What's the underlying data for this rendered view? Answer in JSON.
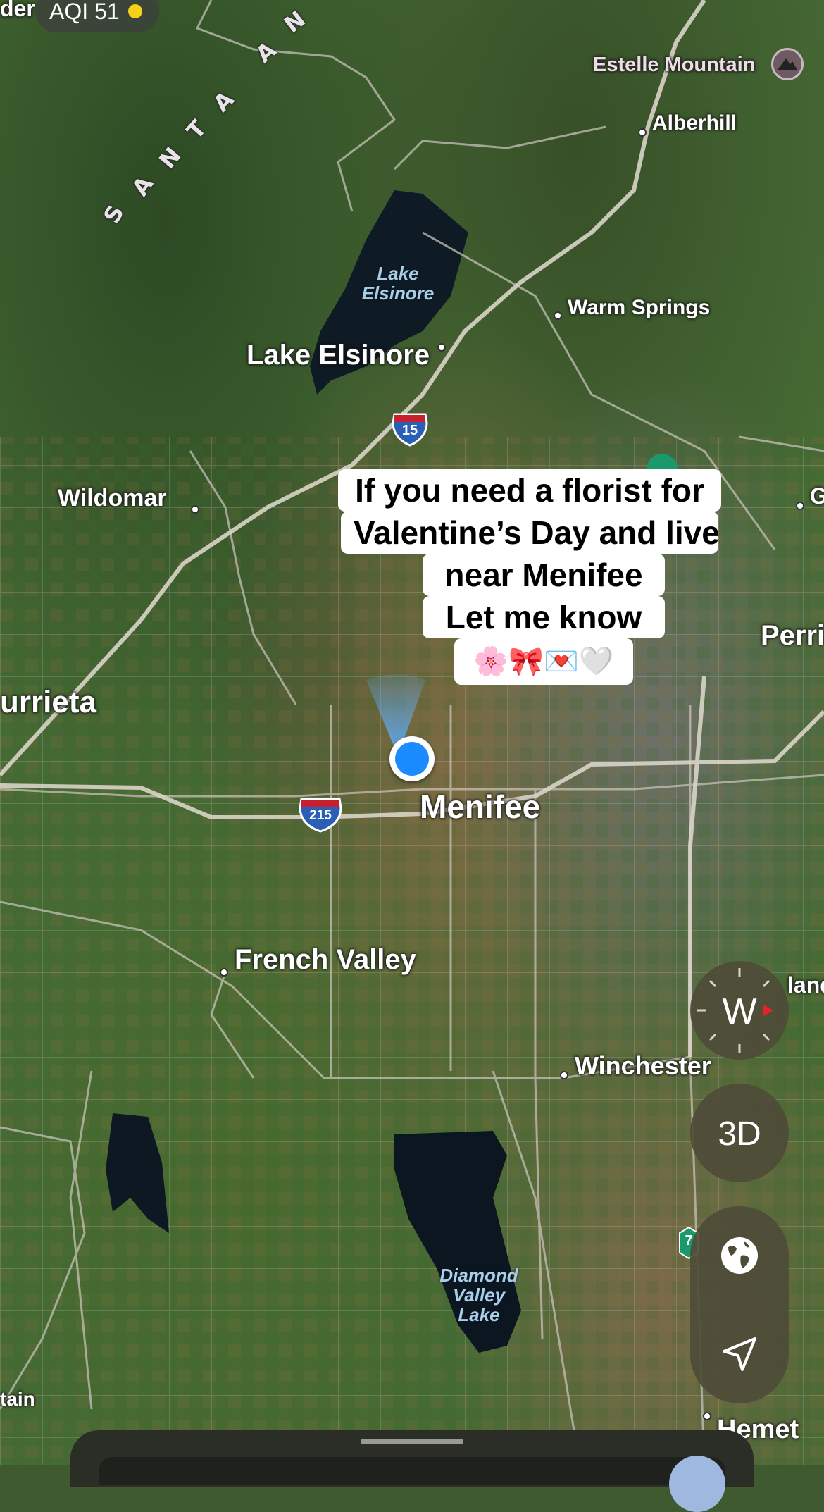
{
  "status": {
    "aqi_label": "AQI 51",
    "aqi_color": "#f7d118",
    "edge_text": "der"
  },
  "places": {
    "estelle_mountain": "Estelle Mountain",
    "alberhill": "Alberhill",
    "warm_springs": "Warm Springs",
    "lake_elsinore": "Lake Elsinore",
    "lake_elsinore_water": "Lake Elsinore",
    "wildomar": "Wildomar",
    "murrieta": "urrieta",
    "menifee": "Menifee",
    "perris": "Perri",
    "g_edge": "G",
    "french_valley": "French Valley",
    "winchester": "Winchester",
    "homeland": "land",
    "diamond_valley_lake": "Diamond Valley Lake",
    "hemet": "Hemet",
    "mountain_edge": "tain",
    "santa_ana_letters": [
      "S",
      "A",
      "N",
      "T",
      "A",
      "A",
      "N"
    ]
  },
  "highways": {
    "i15": "15",
    "i215": "215",
    "sr7x": "7"
  },
  "caption": {
    "lines": [
      "If you need a florist for",
      "Valentine’s Day and live",
      "near Menifee",
      "Let me know",
      "🌸🎀💌🤍"
    ]
  },
  "controls": {
    "compass_heading": "W",
    "mode_button": "3D",
    "globe_icon": "globe-icon",
    "location_icon": "location-arrow-icon"
  },
  "colors": {
    "user_dot": "#1a8cff",
    "interstate_blue": "#2a5fb8",
    "interstate_red": "#c8202f",
    "control_bg": "#4e4c38"
  }
}
